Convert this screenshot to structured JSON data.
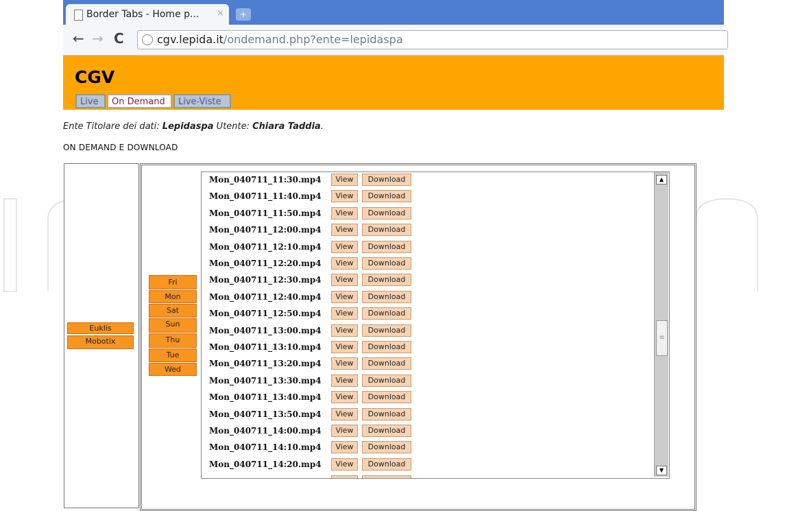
{
  "browser": {
    "tab_title": "Border Tabs - Home p...",
    "tab_close": "×",
    "new_tab": "+",
    "url_host": "cgv.lepida.it",
    "url_path": "/ondemand.php?ente=lepidaspa",
    "back": "←",
    "forward": "→",
    "reload": "C"
  },
  "site": {
    "title": "CGV",
    "tabs": [
      "Live",
      "On Demand",
      "Live-Viste"
    ],
    "active_tab": "On Demand"
  },
  "owner": {
    "prefix": "Ente Titolare dei dati: ",
    "owner_name": "Lepidaspa",
    "user_prefix": "  Utente: ",
    "user_name": "Chiara Taddia",
    "suffix": "."
  },
  "section_title": "ON DEMAND E DOWNLOAD",
  "cameras": [
    "Euklis",
    "Mobotix"
  ],
  "days": [
    "Fri",
    "Mon",
    "Sat",
    "Sun",
    "Thu",
    "Tue",
    "Wed"
  ],
  "files": [
    "Mon_040711_11:30.mp4",
    "Mon_040711_11:40.mp4",
    "Mon_040711_11:50.mp4",
    "Mon_040711_12:00.mp4",
    "Mon_040711_12:10.mp4",
    "Mon_040711_12:20.mp4",
    "Mon_040711_12:30.mp4",
    "Mon_040711_12:40.mp4",
    "Mon_040711_12:50.mp4",
    "Mon_040711_13:00.mp4",
    "Mon_040711_13:10.mp4",
    "Mon_040711_13:20.mp4",
    "Mon_040711_13:30.mp4",
    "Mon_040711_13:40.mp4",
    "Mon_040711_13:50.mp4",
    "Mon_040711_14:00.mp4",
    "Mon_040711_14:10.mp4",
    "Mon_040711_14:20.mp4"
  ],
  "view_label": "View",
  "download_label": "Download",
  "colors": {
    "header": "#ffa500",
    "button_orange": "#f79520",
    "button_peach": "#f8d3b2",
    "chrome_blue": "#4d7ed0"
  }
}
